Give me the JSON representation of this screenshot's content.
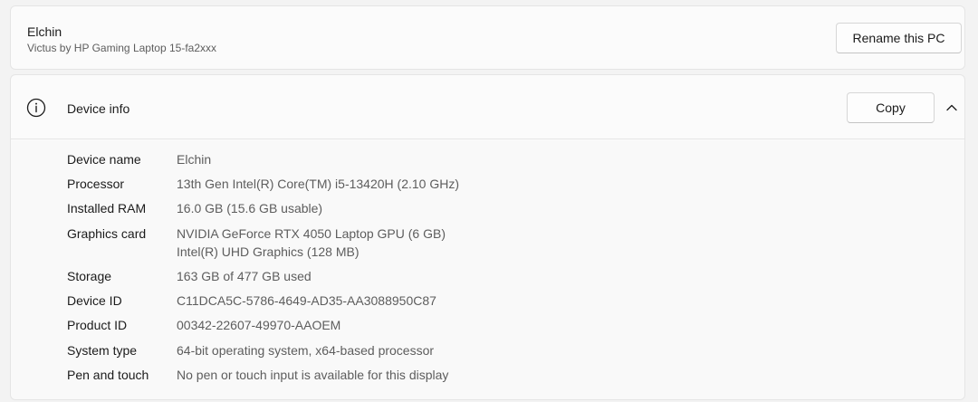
{
  "pc": {
    "name": "Elchin",
    "model": "Victus by HP Gaming Laptop 15-fa2xxx",
    "rename_label": "Rename this PC"
  },
  "device_info": {
    "title": "Device info",
    "icon": "info-icon",
    "copy_label": "Copy",
    "collapse_icon": "chevron-up-icon",
    "specs": [
      {
        "label": "Device name",
        "value": "Elchin",
        "value2": ""
      },
      {
        "label": "Processor",
        "value": "13th Gen Intel(R) Core(TM) i5-13420H (2.10 GHz)",
        "value2": ""
      },
      {
        "label": "Installed RAM",
        "value": "16.0 GB (15.6 GB usable)",
        "value2": ""
      },
      {
        "label": "Graphics card",
        "value": "NVIDIA GeForce RTX 4050 Laptop GPU (6 GB)",
        "value2": "Intel(R) UHD Graphics (128 MB)"
      },
      {
        "label": "Storage",
        "value": "163 GB of 477 GB used",
        "value2": ""
      },
      {
        "label": "Device ID",
        "value": "C11DCA5C-5786-4649-AD35-AA3088950C87",
        "value2": ""
      },
      {
        "label": "Product ID",
        "value": "00342-22607-49970-AAOEM",
        "value2": ""
      },
      {
        "label": "System type",
        "value": "64-bit operating system, x64-based processor",
        "value2": ""
      },
      {
        "label": "Pen and touch",
        "value": "No pen or touch input is available for this display",
        "value2": ""
      }
    ]
  }
}
